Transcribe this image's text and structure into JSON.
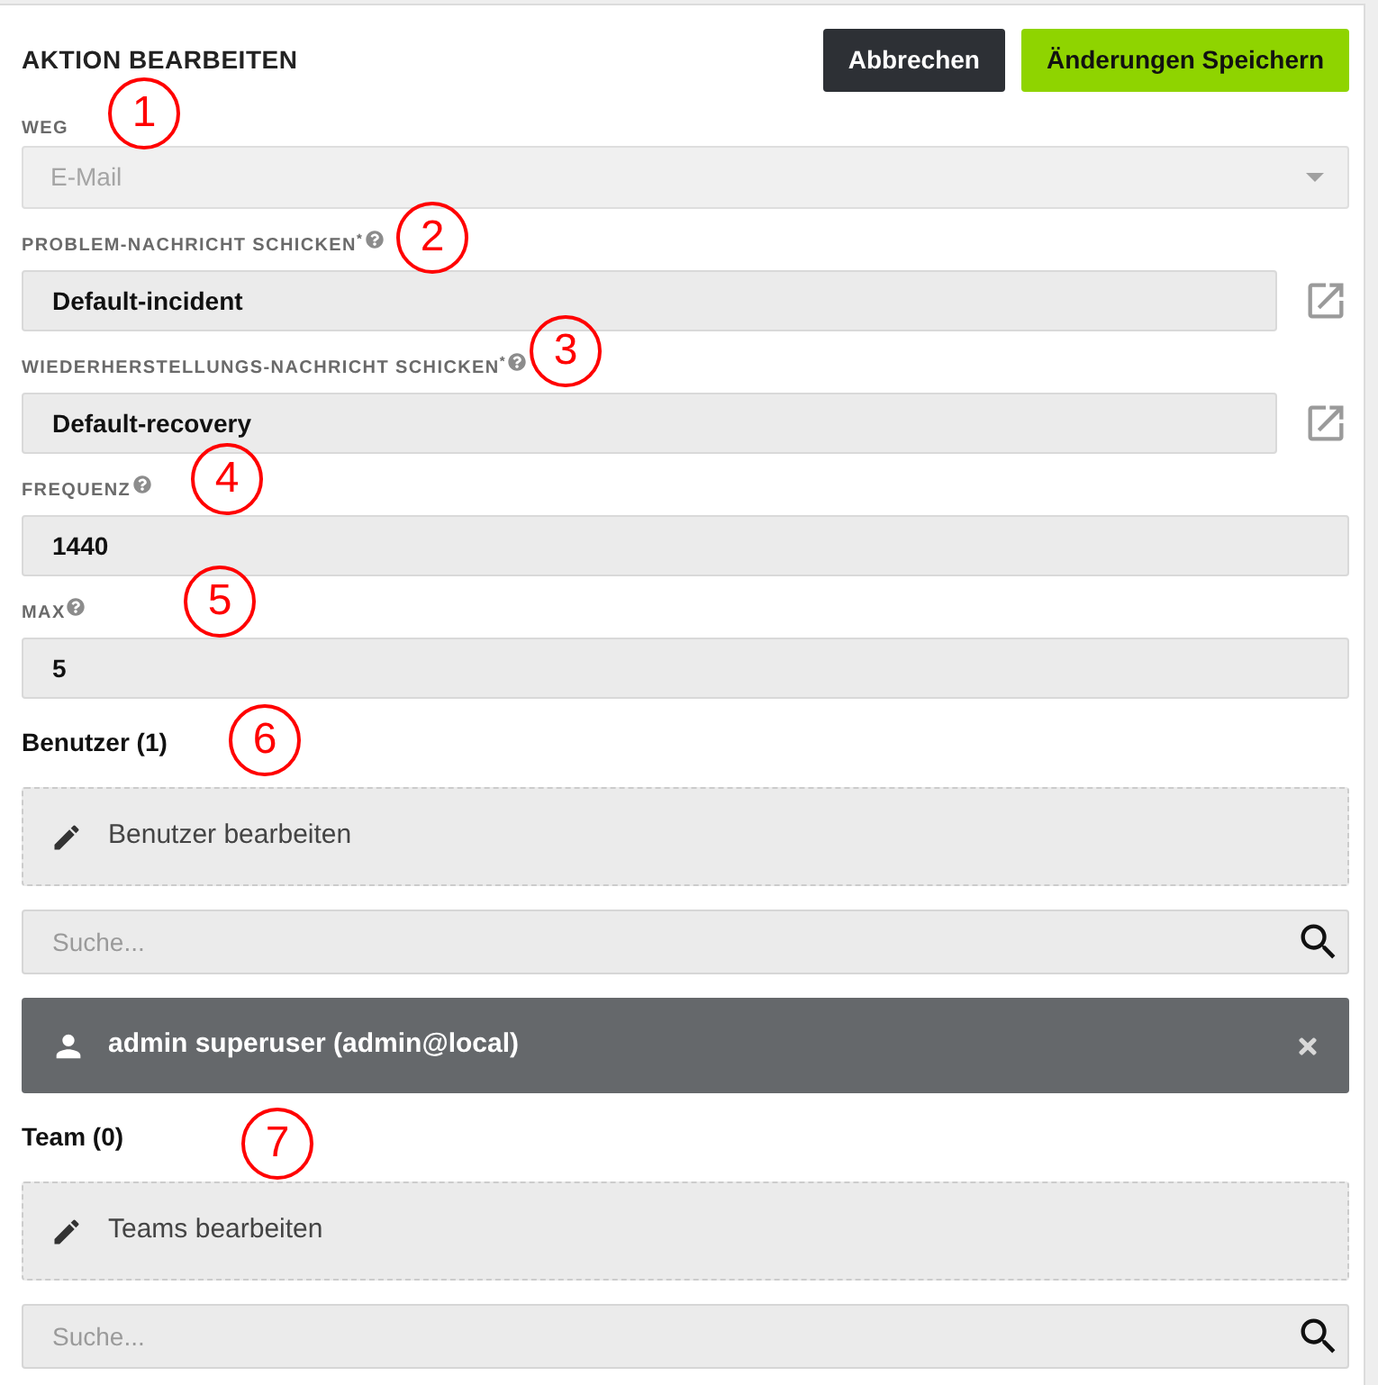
{
  "header": {
    "title": "AKTION BEARBEITEN",
    "buttons": [
      {
        "label": "Abbrechen",
        "kind": "secondary"
      },
      {
        "label": "Änderungen Speichern",
        "kind": "primary"
      }
    ]
  },
  "fields": [
    {
      "kind": "select",
      "label": "WEG",
      "value": "E-Mail",
      "disabled": true
    },
    {
      "kind": "link_input",
      "label": "PROBLEM-NACHRICHT SCHICKEN$^{*}$",
      "value": "Default-incident",
      "help": true
    },
    {
      "kind": "link_input",
      "label": "WIEDERHERSTELLUNGS-NACHRICHT SCHICKEN$^{*}$",
      "value": "Default-recovery",
      "help": true
    },
    {
      "kind": "input",
      "label": "FREQUENZ",
      "value": "1440",
      "help": true
    },
    {
      "kind": "input",
      "label": "MAX",
      "value": "5",
      "help": true
    }
  ],
  "sections": [
    {
      "title": "Benutzer (1)",
      "edit_label": "Benutzer bearbeiten",
      "search": {
        "placeholder": "Suche..."
      },
      "members": [
        {
          "name": "admin superuser (admin@local)"
        }
      ]
    },
    {
      "title": "Team (0)",
      "edit_label": "Teams bearbeiten",
      "search": {
        "placeholder": "Suche..."
      }
    }
  ],
  "callouts": [
    {
      "number": "1"
    },
    {
      "number": "2"
    },
    {
      "number": "3"
    },
    {
      "number": "4"
    },
    {
      "number": "5"
    },
    {
      "number": "6"
    },
    {
      "number": "7"
    }
  ]
}
